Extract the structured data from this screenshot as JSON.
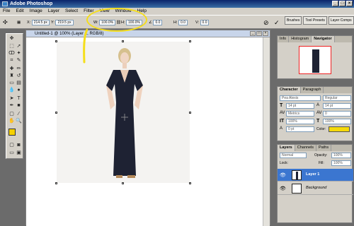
{
  "app": {
    "title": "Adobe Photoshop"
  },
  "menu": [
    "File",
    "Edit",
    "Image",
    "Layer",
    "Select",
    "Filter",
    "View",
    "Window",
    "Help"
  ],
  "options": {
    "x_label": "X:",
    "x_value": "214.5 px",
    "y_label": "Y:",
    "y_value": "219.5 px",
    "w_label": "W:",
    "w_value": "100.0%",
    "h_label": "H:",
    "h_value": "100.0%",
    "angle_value": "0.0",
    "h_skew_label": "H:",
    "h_skew_value": "0.0",
    "v_skew_label": "V:",
    "v_skew_value": "0.0"
  },
  "panel_well": [
    "Brushes",
    "Tool Presets",
    "Layer Comps"
  ],
  "document": {
    "title": "Untitled-1 @ 100% (Layer 1, RGB/8)"
  },
  "navigator": {
    "tabs": [
      "Info",
      "Histogram",
      "Navigator"
    ]
  },
  "character": {
    "tabs": [
      "Character",
      "Paragraph"
    ],
    "font_family": "Pea Alexis",
    "font_style": "Regular",
    "size": "14 pt",
    "leading": "14 pt",
    "kerning": "Metrics",
    "tracking": "0",
    "vscale": "100%",
    "hscale": "100%",
    "baseline": "0 pt",
    "color_label": "Color:",
    "color_value": "#f5d90a"
  },
  "layers": {
    "tabs": [
      "Layers",
      "Channels",
      "Paths"
    ],
    "blend_mode": "Normal",
    "opacity_label": "Opacity:",
    "opacity_value": "100%",
    "lock_label": "Lock:",
    "fill_label": "Fill:",
    "fill_value": "100%",
    "items": [
      "Layer 1",
      "Background"
    ]
  },
  "colors": {
    "annotation": "#f5de1a",
    "selected_layer": "#3b76d0",
    "foreground": "#f5d000"
  }
}
